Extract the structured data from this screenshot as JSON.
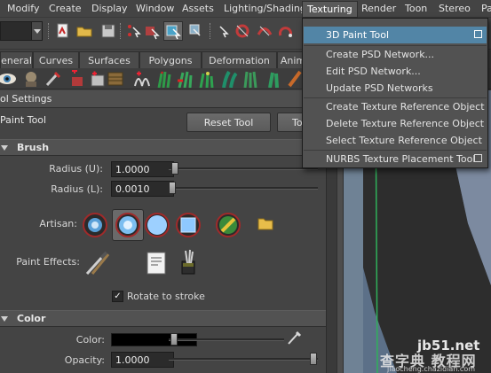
{
  "menubar": {
    "items": [
      "Modify",
      "Create",
      "Display",
      "Window",
      "Assets",
      "Lighting/Shading",
      "Texturing",
      "Render",
      "Toon",
      "Stereo",
      "Pa"
    ],
    "active_index": 6
  },
  "shelf_tabs": [
    "eneral",
    "Curves",
    "Surfaces",
    "Polygons",
    "Deformation",
    "Anim"
  ],
  "tool_settings": {
    "title": "ol Settings",
    "tool_name": "Paint Tool",
    "reset_button": "Reset Tool",
    "tool_help_button": "To"
  },
  "brush": {
    "section_label": "Brush",
    "radius_u_label": "Radius (U):",
    "radius_u_value": "1.0000",
    "radius_l_label": "Radius (L):",
    "radius_l_value": "0.0010",
    "artisan_label": "Artisan:",
    "paint_effects_label": "Paint Effects:",
    "rotate_label": "Rotate to stroke",
    "rotate_checked": true
  },
  "color": {
    "section_label": "Color",
    "color_label": "Color:",
    "color_value": "#000000",
    "opacity_label": "Opacity:",
    "opacity_value": "1.0000"
  },
  "texturing_menu": {
    "items": [
      {
        "label": "3D Paint Tool",
        "highlighted": true,
        "option_box": true
      },
      {
        "label": "Create PSD Network...",
        "highlighted": false,
        "option_box": false
      },
      {
        "label": "Edit PSD Network...",
        "highlighted": false,
        "option_box": false
      },
      {
        "label": "Update PSD Networks",
        "highlighted": false,
        "option_box": false
      },
      {
        "label": "Create Texture Reference Object",
        "highlighted": false,
        "option_box": false
      },
      {
        "label": "Delete Texture Reference Object",
        "highlighted": false,
        "option_box": false
      },
      {
        "label": "Select Texture Reference Object",
        "highlighted": false,
        "option_box": false
      },
      {
        "label": "NURBS Texture Placement Tool",
        "highlighted": false,
        "option_box": true
      }
    ]
  },
  "watermark": {
    "line1": "jb51.net",
    "line2": "查字典 教程网",
    "line3": "jiaocheng.chazidian.com"
  },
  "colors": {
    "accent_highlight": "#5285a6",
    "panel_bg": "#444444",
    "section_bg": "#525252"
  }
}
